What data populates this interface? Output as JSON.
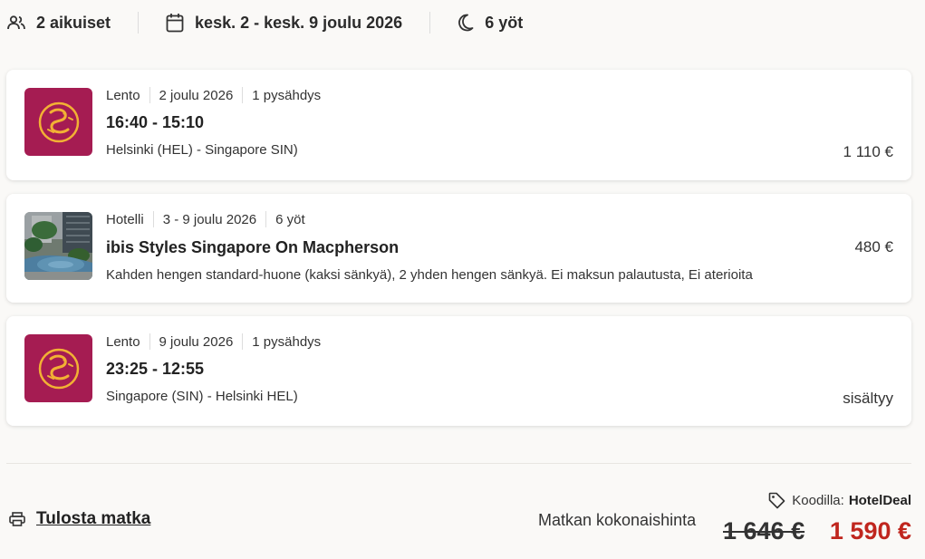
{
  "summary": {
    "travelers": "2 aikuiset",
    "dates": "kesk. 2 - kesk. 9 joulu 2026",
    "nights": "6 yöt"
  },
  "items": [
    {
      "type": "Lento",
      "date": "2 joulu 2026",
      "extra": "1 pysähdys",
      "title": "16:40 - 15:10",
      "desc": "Helsinki (HEL) - Singapore SIN)",
      "price": "1 110 €"
    },
    {
      "type": "Hotelli",
      "date": "3 - 9 joulu 2026",
      "extra": "6 yöt",
      "title": "ibis Styles Singapore On Macpherson",
      "desc": "Kahden hengen standard-huone (kaksi sänkyä), 2 yhden hengen sänkyä. Ei maksun palautusta, Ei aterioita",
      "price": "480 €"
    },
    {
      "type": "Lento",
      "date": "9 joulu 2026",
      "extra": "1 pysähdys",
      "title": "23:25 - 12:55",
      "desc": "Singapore (SIN) - Helsinki HEL)",
      "price": "sisältyy"
    }
  ],
  "footer": {
    "print_label": "Tulosta matka",
    "total_label": "Matkan kokonaishinta",
    "promo_label": "Koodilla:",
    "promo_code": "HotelDeal",
    "old_price": "1 646 €",
    "new_price": "1 590 €"
  },
  "colors": {
    "airline_brand": "#a51c52",
    "airline_logo_gold": "#f2b134",
    "discount_price": "#c0261e"
  },
  "icons": [
    "people-icon",
    "calendar-icon",
    "moon-icon",
    "airline-logo",
    "hotel-photo",
    "tag-icon",
    "printer-icon"
  ]
}
